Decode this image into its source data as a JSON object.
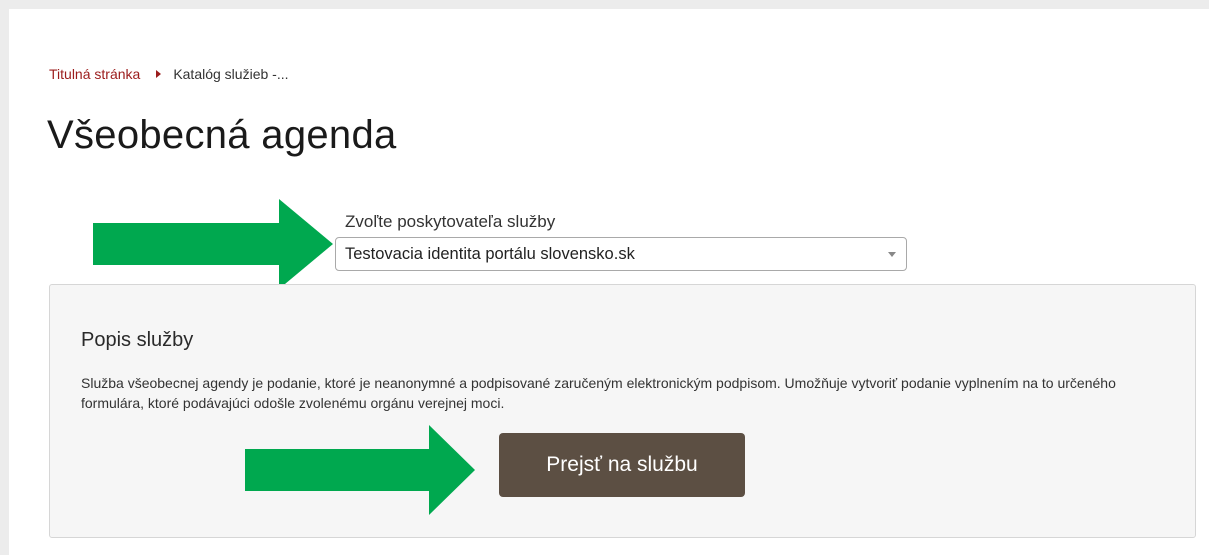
{
  "breadcrumb": {
    "home_label": "Titulná stránka",
    "current_label": "Katalóg služieb -..."
  },
  "page": {
    "title": "Všeobecná agenda"
  },
  "provider": {
    "label": "Zvoľte poskytovateľa služby",
    "selected_value": "Testovacia identita portálu slovensko.sk"
  },
  "service": {
    "heading": "Popis služby",
    "description": "Služba všeobecnej agendy je podanie, ktoré je neanonymné a podpisované zaručeným elektronickým podpisom. Umožňuje vytvoriť podanie vyplnením na to určeného formulára, ktoré podávajúci odošle zvolenému orgánu verejnej moci.",
    "button_label": "Prejsť na službu"
  },
  "annotations": {
    "arrow_color": "#00a84f",
    "brand_link_color": "#9b1c1c",
    "button_color": "#5c4f43"
  }
}
